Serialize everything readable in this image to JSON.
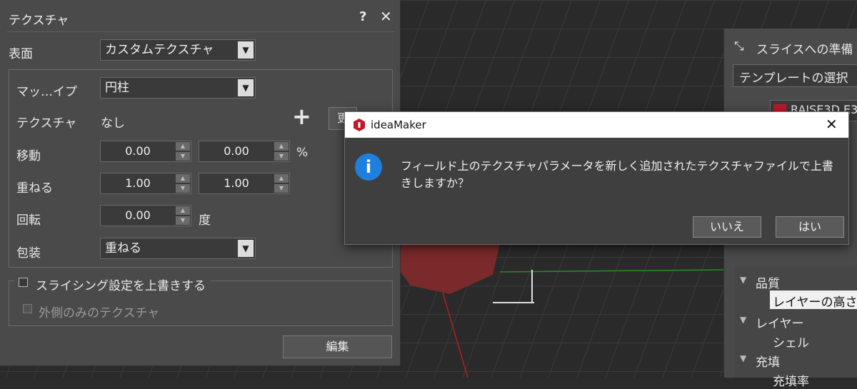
{
  "panel": {
    "title": "テクスチャ",
    "help": "?",
    "close": "✕",
    "surface_label": "表面",
    "surface_value": "カスタムテクスチャ",
    "map_label": "マッ…イプ",
    "map_value": "円柱",
    "texture_label": "テクスチャ",
    "texture_value": "なし",
    "add_symbol": "+",
    "replace_label": "更",
    "move_label": "移動",
    "move_x": "0.00",
    "move_y": "0.00",
    "move_unit": "%",
    "repeat_label": "重ねる",
    "repeat_x": "1.00",
    "repeat_y": "1.00",
    "rotate_label": "回転",
    "rotate_value": "0.00",
    "rotate_unit": "度",
    "wrap_label": "包装",
    "wrap_value": "重ねる",
    "override_label": "スライシング設定を上書きする",
    "outer_only_label": "外側のみのテクスチャ",
    "edit_button": "編集"
  },
  "right_panel": {
    "header_icon": "collapse-icon",
    "header": "スライスへの準備",
    "template_button": "テンプレートの選択",
    "printer": "RAISE3D E3",
    "quality": "品質",
    "layer_height": "レイヤーの高さ",
    "layer": "レイヤー",
    "shell": "シェル",
    "infill": "充填",
    "infill_rate": "充填率"
  },
  "dialog": {
    "title": "ideaMaker",
    "close": "✕",
    "info_icon": "i",
    "message": "フィールド上のテクスチャパラメータを新しく追加されたテクスチャファイルで上書きしますか？",
    "no_button": "いいえ",
    "yes_button": "はい"
  },
  "colors": {
    "accent_info": "#1f7fdf",
    "logo_red": "#c0182a",
    "model_red": "#7a2a2a",
    "grid_line": "#3a3a3a"
  }
}
